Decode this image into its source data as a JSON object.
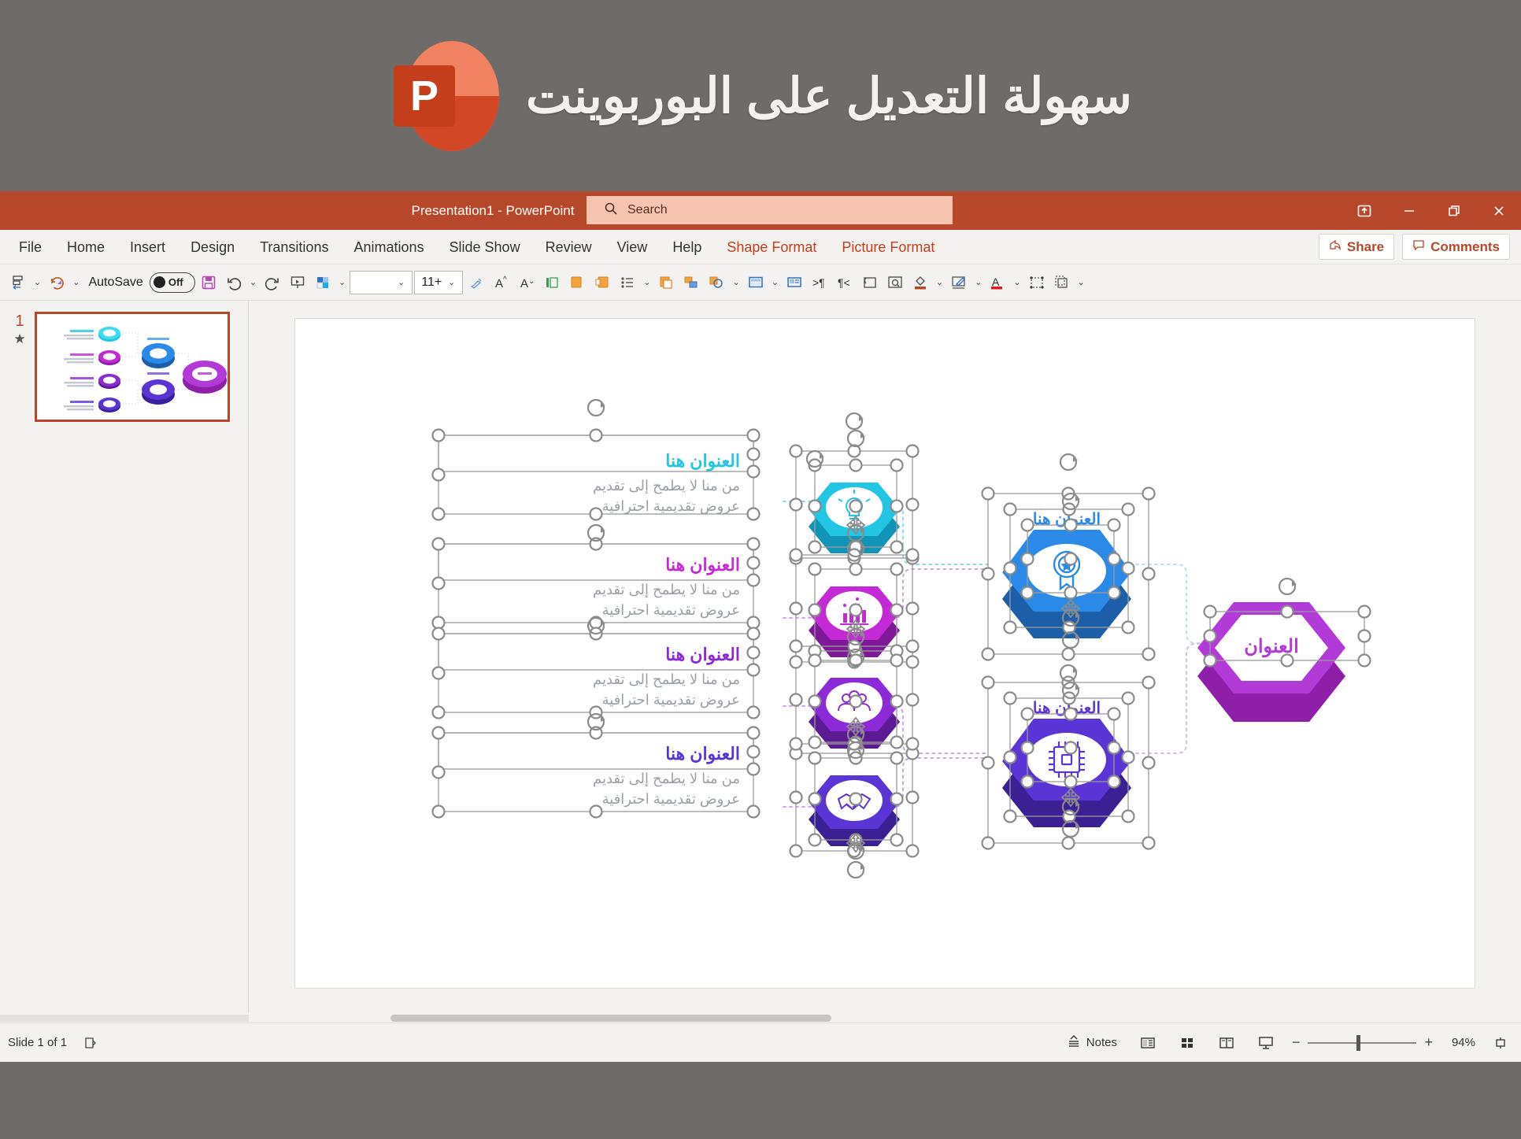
{
  "promo": {
    "logo_letter": "P",
    "title": "سهولة التعديل على البوربوينت"
  },
  "titlebar": {
    "document_title": "Presentation1  -  PowerPoint",
    "search_placeholder": "Search",
    "search_icon": "search-icon",
    "ribbon_display_icon": "ribbon-display-options-icon",
    "minimize_icon": "minimize-icon",
    "restore_icon": "restore-icon",
    "close_icon": "close-icon"
  },
  "ribbon": {
    "tabs": [
      {
        "label": "File",
        "accent": false
      },
      {
        "label": "Home",
        "accent": false
      },
      {
        "label": "Insert",
        "accent": false
      },
      {
        "label": "Design",
        "accent": false
      },
      {
        "label": "Transitions",
        "accent": false
      },
      {
        "label": "Animations",
        "accent": false
      },
      {
        "label": "Slide Show",
        "accent": false
      },
      {
        "label": "Review",
        "accent": false
      },
      {
        "label": "View",
        "accent": false
      },
      {
        "label": "Help",
        "accent": false
      },
      {
        "label": "Shape Format",
        "accent": true
      },
      {
        "label": "Picture Format",
        "accent": true
      }
    ],
    "share_label": "Share",
    "comments_label": "Comments"
  },
  "toolbar": {
    "autosave_label": "AutoSave",
    "autosave_state": "Off",
    "font_name": "",
    "font_size": "11+",
    "items": [
      "quick-access-icon",
      "repeat-icon",
      "save-icon",
      "undo-icon",
      "redo-icon",
      "start-slideshow-icon",
      "shape-fill-icon",
      "format-painter-icon",
      "increase-font-size-icon",
      "decrease-font-size-icon",
      "text-direction-icon",
      "align-left-icon",
      "align-right-icon",
      "bullets-icon",
      "arrange-icon",
      "group-icon",
      "shape-outline-icon",
      "layout-icon",
      "new-slide-icon",
      "indent-increase-icon",
      "indent-decrease-icon",
      "replace-icon",
      "find-icon",
      "fill-color-icon",
      "draw-icon",
      "font-color-icon",
      "select-objects-icon",
      "group-objects-icon",
      "more-commands-icon"
    ]
  },
  "slide_pane": {
    "slide_number": "1",
    "star_glyph": "★"
  },
  "statusbar": {
    "slide_indicator": "Slide 1 of 1",
    "accessibility_icon": "accessibility-checker-icon",
    "notes_label": "Notes",
    "view_normal_icon": "normal-view-icon",
    "view_sorter_icon": "slide-sorter-icon",
    "view_reading_icon": "reading-view-icon",
    "view_slideshow_icon": "slideshow-view-icon",
    "zoom_out_glyph": "−",
    "zoom_in_glyph": "+",
    "zoom_percent": "94%",
    "fit_slide_icon": "fit-slide-to-window-icon"
  },
  "diagram": {
    "left_items": [
      {
        "title": "العنوان هنا",
        "body_line1": "من منا لا يطمح إلى تقديم",
        "body_line2": "عروض تقديمية احترافية",
        "color": "#22c6e3",
        "icon": "lightbulb-icon"
      },
      {
        "title": "العنوان هنا",
        "body_line1": "من منا لا يطمح إلى تقديم",
        "body_line2": "عروض تقديمية احترافية",
        "color": "#c32ad6",
        "icon": "bar-chart-growth-icon"
      },
      {
        "title": "العنوان هنا",
        "body_line1": "من منا لا يطمح إلى تقديم",
        "body_line2": "عروض تقديمية احترافية",
        "color": "#8b2ad6",
        "icon": "people-group-icon"
      },
      {
        "title": "العنوان هنا",
        "body_line1": "من منا لا يطمح إلى تقديم",
        "body_line2": "عروض تقديمية احترافية",
        "color": "#5b34d6",
        "icon": "handshake-icon"
      }
    ],
    "middle_items": [
      {
        "title": "العنوان هنا",
        "color": "#2b8ae8",
        "icon": "award-badge-icon"
      },
      {
        "title": "العنوان هنا",
        "color": "#5b34d6",
        "icon": "microchip-icon"
      }
    ],
    "right_item": {
      "title": "العنوان",
      "color": "#b23ad6"
    }
  }
}
